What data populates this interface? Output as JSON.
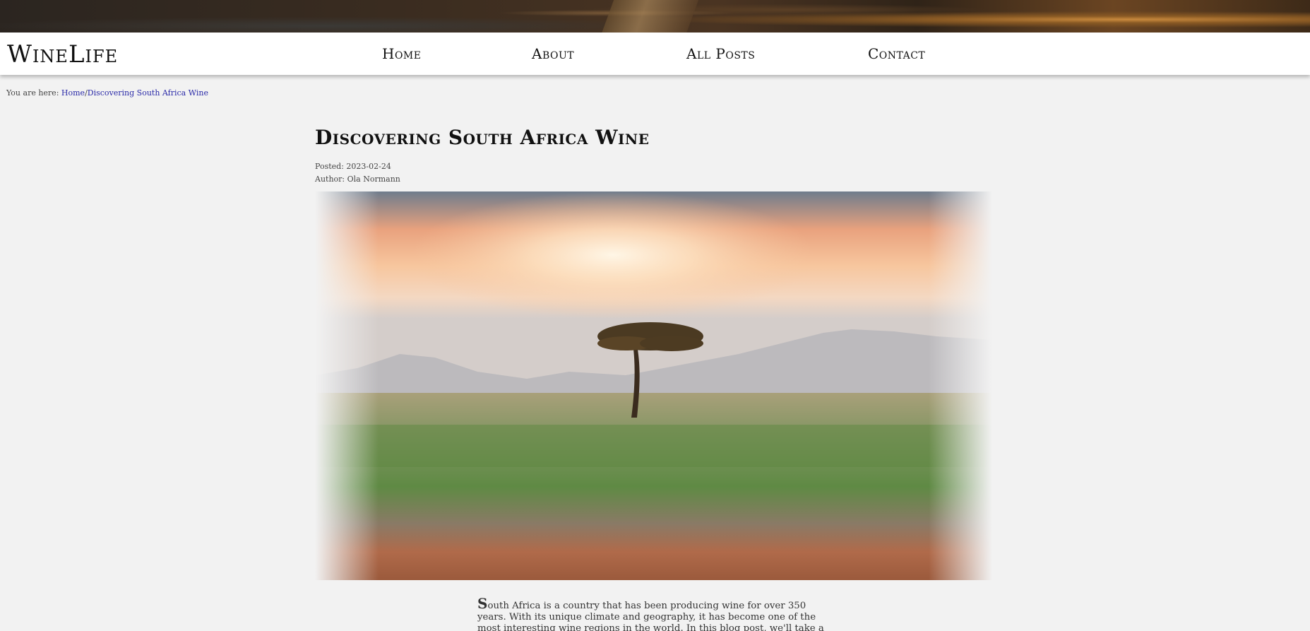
{
  "site": {
    "brand": "WineLife"
  },
  "nav": [
    {
      "label": "Home"
    },
    {
      "label": "About"
    },
    {
      "label": "All Posts"
    },
    {
      "label": "Contact"
    }
  ],
  "breadcrumb": {
    "prefix": "You are here: ",
    "home": "Home",
    "separator": "/",
    "current": "Discovering South Africa Wine"
  },
  "post": {
    "title": "Discovering South Africa Wine",
    "posted": "Posted: 2023-02-24",
    "author": "Author: Ola Normann",
    "dropcap": "S",
    "body": "outh Africa is a country that has been producing wine for over 350 years. With its unique climate and geography, it has become one of the most interesting wine regions in the world. In this blog post, we'll take a journey through the wine regions"
  }
}
